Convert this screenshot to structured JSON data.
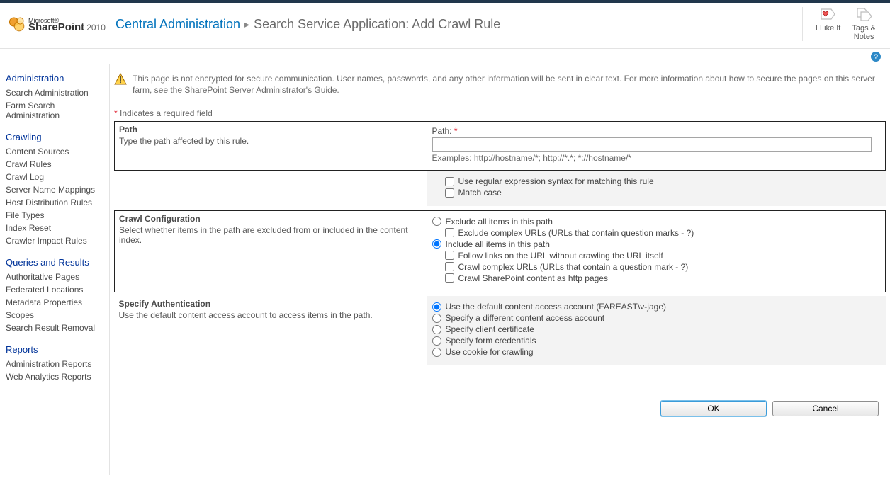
{
  "logo": {
    "microsoft": "Microsoft®",
    "product": "SharePoint",
    "year": "2010"
  },
  "breadcrumb": {
    "root": "Central Administration",
    "sep": "▸",
    "page": "Search Service Application: Add Crawl Rule"
  },
  "headerActions": {
    "like": "I Like It",
    "tags": "Tags &\nNotes"
  },
  "warning": "This page is not encrypted for secure communication. User names, passwords, and any other information will be sent in clear text. For more information about how to secure the pages on this server farm, see the SharePoint Server Administrator's Guide.",
  "requiredNote": "Indicates a required field",
  "nav": {
    "administration": {
      "head": "Administration",
      "items": [
        "Search Administration",
        "Farm Search Administration"
      ]
    },
    "crawling": {
      "head": "Crawling",
      "items": [
        "Content Sources",
        "Crawl Rules",
        "Crawl Log",
        "Server Name Mappings",
        "Host Distribution Rules",
        "File Types",
        "Index Reset",
        "Crawler Impact Rules"
      ]
    },
    "queries": {
      "head": "Queries and Results",
      "items": [
        "Authoritative Pages",
        "Federated Locations",
        "Metadata Properties",
        "Scopes",
        "Search Result Removal"
      ]
    },
    "reports": {
      "head": "Reports",
      "items": [
        "Administration Reports",
        "Web Analytics Reports"
      ]
    }
  },
  "pathSection": {
    "title": "Path",
    "desc": "Type the path affected by this rule.",
    "label": "Path:",
    "examples": "Examples: http://hostname/*; http://*.*; *://hostname/*",
    "regex": "Use regular expression syntax for matching this rule",
    "matchcase": "Match case"
  },
  "crawlConfig": {
    "title": "Crawl Configuration",
    "desc": "Select whether items in the path are excluded from or included in the content index.",
    "exclude": "Exclude all items in this path",
    "excludeComplex": "Exclude complex URLs (URLs that contain question marks - ?)",
    "include": "Include all items in this path",
    "followLinks": "Follow links on the URL without crawling the URL itself",
    "crawlComplex": "Crawl complex URLs (URLs that contain a question mark - ?)",
    "crawlSP": "Crawl SharePoint content as http pages"
  },
  "auth": {
    "title": "Specify Authentication",
    "desc": "Use the default content access account to access items in the path.",
    "default": "Use the default content access account (FAREAST\\v-jage)",
    "different": "Specify a different content access account",
    "clientCert": "Specify client certificate",
    "formCreds": "Specify form credentials",
    "cookie": "Use cookie for crawling"
  },
  "buttons": {
    "ok": "OK",
    "cancel": "Cancel"
  }
}
